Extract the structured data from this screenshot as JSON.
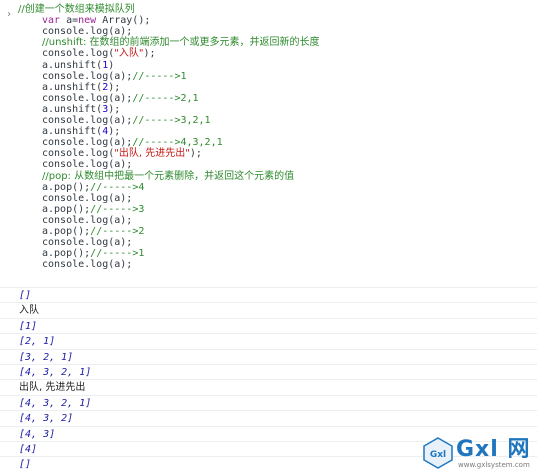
{
  "console": {
    "prompt_glyph": "›",
    "input_lines": [
      [
        {
          "t": "//创建一个数组来模拟队列",
          "c": "comment cn"
        }
      ],
      [
        {
          "t": "var",
          "c": "keyword"
        },
        {
          "t": " a=",
          "c": "plain"
        },
        {
          "t": "new",
          "c": "keyword"
        },
        {
          "t": " Array();",
          "c": "plain"
        }
      ],
      [
        {
          "t": "console.log(a);",
          "c": "plain"
        }
      ],
      [
        {
          "t": "//unshift: 在数组的前端添加一个或更多元素，并返回新的长度",
          "c": "comment cn"
        }
      ],
      [
        {
          "t": "console.log(",
          "c": "plain"
        },
        {
          "t": "\"入队\"",
          "c": "string cn"
        },
        {
          "t": ");",
          "c": "plain"
        }
      ],
      [
        {
          "t": "a.unshift(",
          "c": "plain"
        },
        {
          "t": "1",
          "c": "number"
        },
        {
          "t": ")",
          "c": "plain"
        }
      ],
      [
        {
          "t": "console.log(a);",
          "c": "plain"
        },
        {
          "t": "//----->1",
          "c": "comment"
        }
      ],
      [
        {
          "t": "a.unshift(",
          "c": "plain"
        },
        {
          "t": "2",
          "c": "number"
        },
        {
          "t": ");",
          "c": "plain"
        }
      ],
      [
        {
          "t": "console.log(a);",
          "c": "plain"
        },
        {
          "t": "//----->2,1",
          "c": "comment"
        }
      ],
      [
        {
          "t": "a.unshift(",
          "c": "plain"
        },
        {
          "t": "3",
          "c": "number"
        },
        {
          "t": ");",
          "c": "plain"
        }
      ],
      [
        {
          "t": "console.log(a);",
          "c": "plain"
        },
        {
          "t": "//----->3,2,1",
          "c": "comment"
        }
      ],
      [
        {
          "t": "a.unshift(",
          "c": "plain"
        },
        {
          "t": "4",
          "c": "number"
        },
        {
          "t": ");",
          "c": "plain"
        }
      ],
      [
        {
          "t": "console.log(a);",
          "c": "plain"
        },
        {
          "t": "//----->4,3,2,1",
          "c": "comment"
        }
      ],
      [
        {
          "t": "console.log(",
          "c": "plain"
        },
        {
          "t": "\"出队, 先进先出\"",
          "c": "string cn"
        },
        {
          "t": ");",
          "c": "plain"
        }
      ],
      [
        {
          "t": "console.log(a);",
          "c": "plain"
        }
      ],
      [
        {
          "t": "//pop: 从数组中把最一个元素删除，并返回这个元素的值",
          "c": "comment cn"
        }
      ],
      [
        {
          "t": "a.pop();",
          "c": "plain"
        },
        {
          "t": "//----->4",
          "c": "comment"
        }
      ],
      [
        {
          "t": "console.log(a);",
          "c": "plain"
        }
      ],
      [
        {
          "t": "a.pop();",
          "c": "plain"
        },
        {
          "t": "//----->3",
          "c": "comment"
        }
      ],
      [
        {
          "t": "console.log(a);",
          "c": "plain"
        }
      ],
      [
        {
          "t": "a.pop();",
          "c": "plain"
        },
        {
          "t": "//----->2",
          "c": "comment"
        }
      ],
      [
        {
          "t": "console.log(a);",
          "c": "plain"
        }
      ],
      [
        {
          "t": "a.pop();",
          "c": "plain"
        },
        {
          "t": "//----->1",
          "c": "comment"
        }
      ],
      [
        {
          "t": "console.log(a);",
          "c": "plain"
        }
      ]
    ],
    "outputs": [
      {
        "text": "[]",
        "kind": "arr"
      },
      {
        "text": "入队",
        "kind": "log"
      },
      {
        "text": "[1]",
        "kind": "arr"
      },
      {
        "text": "[2, 1]",
        "kind": "arr"
      },
      {
        "text": "[3, 2, 1]",
        "kind": "arr"
      },
      {
        "text": "[4, 3, 2, 1]",
        "kind": "arr"
      },
      {
        "text": "出队, 先进先出",
        "kind": "log"
      },
      {
        "text": "[4, 3, 2, 1]",
        "kind": "arr"
      },
      {
        "text": "[4, 3, 2]",
        "kind": "arr"
      },
      {
        "text": "[4, 3]",
        "kind": "arr"
      },
      {
        "text": "[4]",
        "kind": "arr"
      },
      {
        "text": "[]",
        "kind": "arr"
      }
    ]
  },
  "watermark": {
    "logo_text": "Gxl",
    "name": "Gxl 网",
    "url": "www.gxlsystem.com"
  },
  "colors": {
    "comment": "#2e8a2e",
    "keyword": "#9b2393",
    "number": "#1c00cf",
    "string": "#c41a16",
    "array_output": "#1a1aa6",
    "brand": "#1f76bf"
  }
}
